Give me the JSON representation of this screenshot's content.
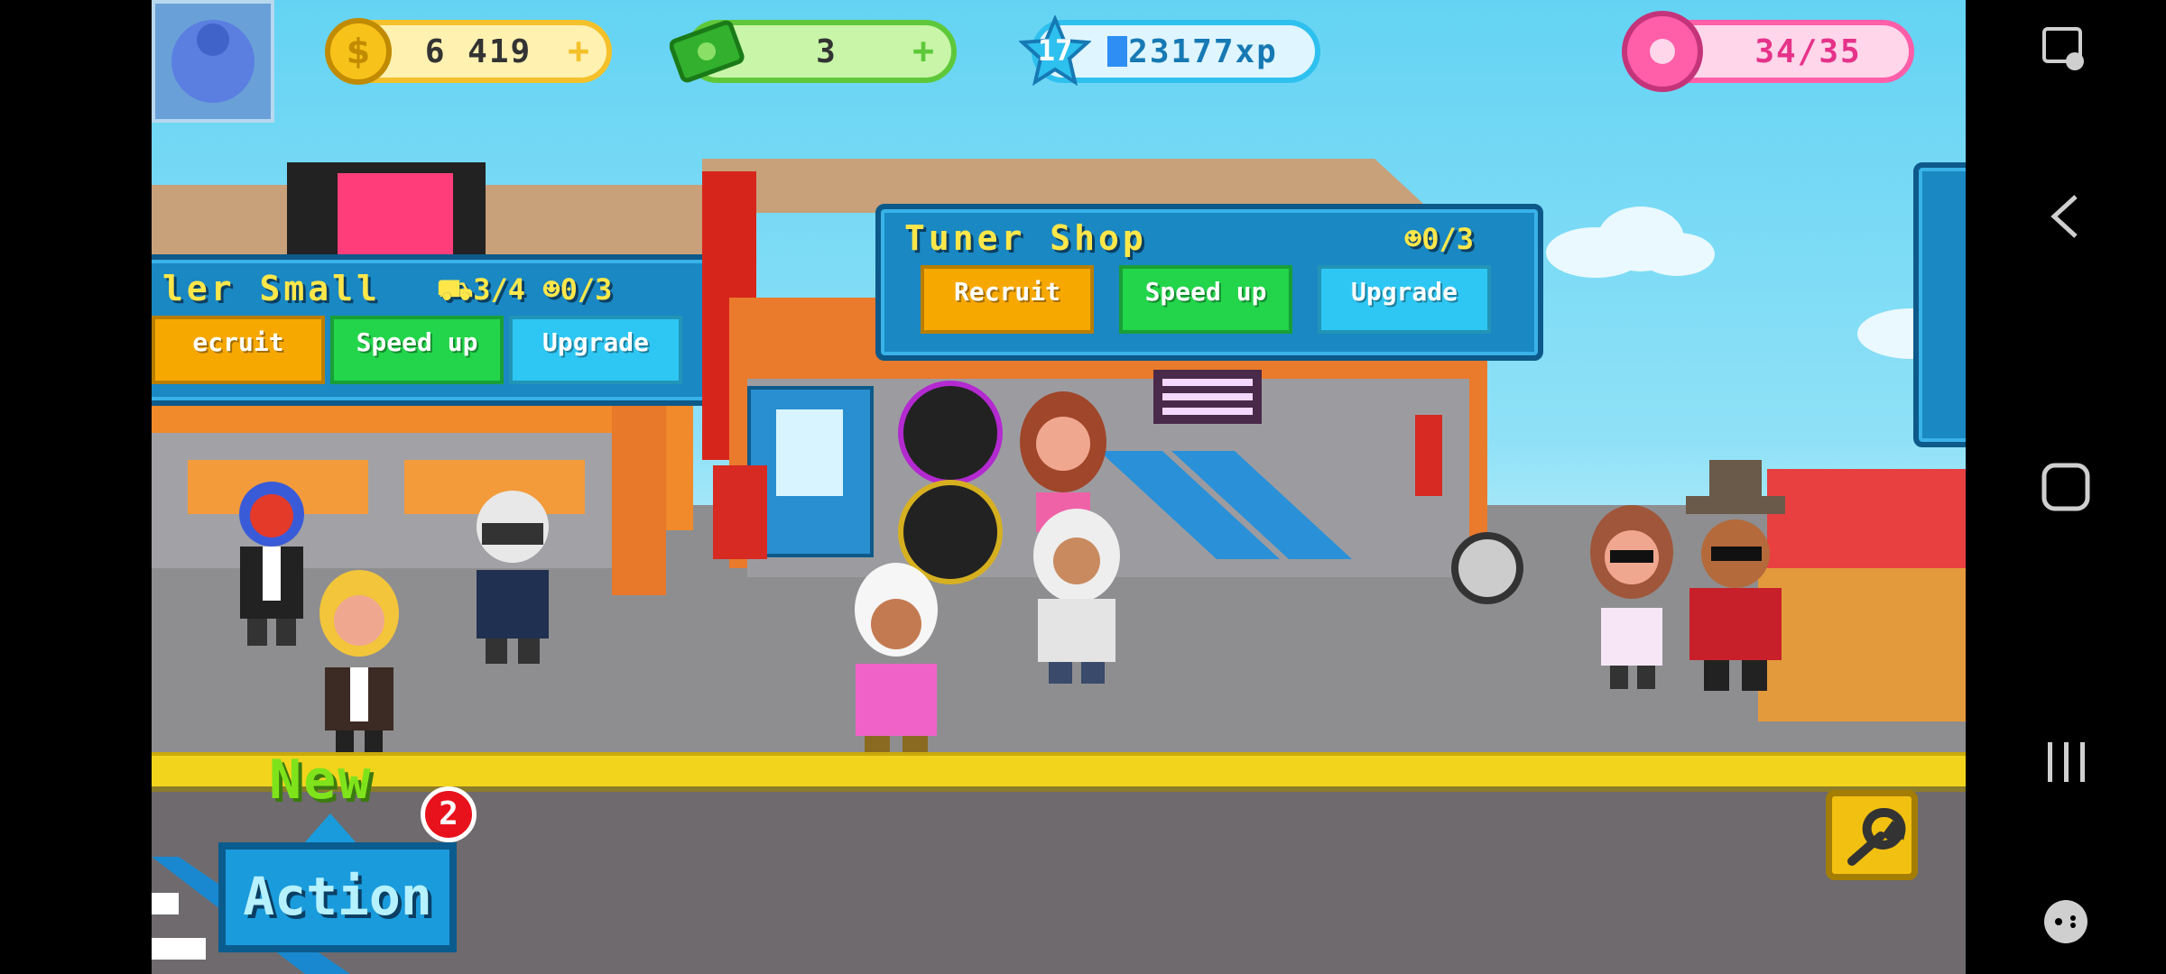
{
  "hud": {
    "coins": "6 419",
    "coins_plus": "+",
    "cash": "3",
    "cash_plus": "+",
    "level": "17",
    "xp": "23177xp",
    "donuts": "34/35"
  },
  "buildings": [
    {
      "title": "ler Small",
      "cars": "3/4",
      "staff": "0/3",
      "buttons": {
        "recruit": "ecruit",
        "speed": "Speed up",
        "upgrade": "Upgrade"
      }
    },
    {
      "title": "Tuner Shop",
      "staff": "0/3",
      "buttons": {
        "recruit": "Recruit",
        "speed": "Speed up",
        "upgrade": "Upgrade"
      }
    }
  ],
  "bottom": {
    "new_label": "New",
    "new_count": "2",
    "action_label": "Action"
  },
  "icons": {
    "avatar": "avatar-icon",
    "coin": "coin-icon",
    "cash": "cash-icon",
    "level": "level-star-icon",
    "donut": "donut-icon",
    "wrench": "wrench-icon",
    "car": "car-icon",
    "staff": "staff-icon"
  },
  "colors": {
    "recruit": "#f7a800",
    "speed": "#22d54a",
    "upgrade": "#2ec7f4",
    "panel": "#1a88c2",
    "accent_yellow": "#ffe74a"
  },
  "xp_progress": 0.1
}
